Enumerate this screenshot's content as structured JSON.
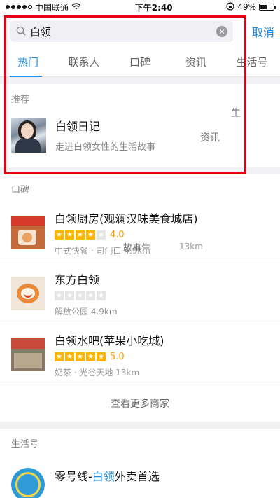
{
  "status": {
    "carrier": "中国联通",
    "time": "下午2:40",
    "battery": "49%"
  },
  "search": {
    "query": "白领",
    "cancel": "取消"
  },
  "tabs": [
    "热门",
    "联系人",
    "口碑",
    "资讯",
    "生活号"
  ],
  "recommend": {
    "label": "推荐",
    "title": "白领日记",
    "subtitle": "走进白领女性的生活故事",
    "ghost_1": "生",
    "ghost_2": "资讯"
  },
  "koubei": {
    "label": "口碑",
    "shops": [
      {
        "name": "白领厨房(观澜汉味美食城店)",
        "rating": "4.0",
        "stars": 4,
        "meta": "中式快餐 · 司门口 4.9km",
        "meta_extra": "13km",
        "ghost": "故事生"
      },
      {
        "name": "东方白领",
        "rating": "",
        "stars": 0,
        "meta": "解放公园 4.9km"
      },
      {
        "name": "白领水吧(苹果小吃城)",
        "rating": "5.0",
        "stars": 5,
        "meta": "奶茶 · 光谷天地 13km"
      }
    ],
    "more": "查看更多商家"
  },
  "life": {
    "label": "生活号",
    "title_pre": "零号线-",
    "title_hl": "白领",
    "title_post": "外卖首选"
  },
  "colors": {
    "accent": "#1f8ee8",
    "highlight_box": "#e60012",
    "star": "#ffb400"
  }
}
